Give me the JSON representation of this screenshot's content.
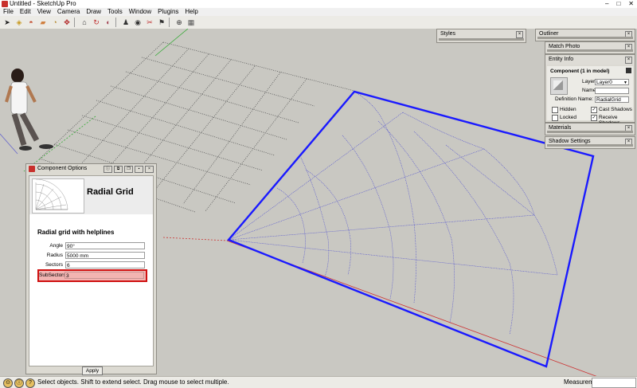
{
  "window": {
    "title": "Untitled - SketchUp Pro",
    "minimize": "–",
    "maximize": "□",
    "close": "✕"
  },
  "menu": [
    "File",
    "Edit",
    "View",
    "Camera",
    "Draw",
    "Tools",
    "Window",
    "Plugins",
    "Help"
  ],
  "toolbar": {
    "groups": [
      [
        "select-icon",
        "component-icon",
        "paint-bucket-icon",
        "eraser-icon",
        "tape-measure-icon",
        "move-icon"
      ],
      [
        "component-options-icon",
        "rotate-icon",
        "shape-icon",
        "walk-icon",
        "look-around-icon"
      ],
      [
        "section-icon",
        "position-camera-icon"
      ],
      [
        "add-location-icon",
        "toggle-terrain-icon"
      ]
    ]
  },
  "trays": {
    "styles": "Styles",
    "outliner": "Outliner",
    "match_photo": "Match Photo",
    "entity_info": {
      "title": "Entity Info",
      "heading": "Component (1 in model)",
      "layer_label": "Layer:",
      "layer_value": "Layer0",
      "name_label": "Name:",
      "name_value": "",
      "definition_label": "Definition Name:",
      "definition_value": "RadialGrid",
      "hidden": "Hidden",
      "locked": "Locked",
      "cast_shadows": "Cast Shadows",
      "receive_shadows": "Receive Shadows"
    },
    "materials": "Materials",
    "shadow_settings": "Shadow Settings"
  },
  "component_options": {
    "title": "Component Options",
    "name": "Radial Grid",
    "subtitle": "Radial grid with helplines",
    "fields": [
      {
        "label": "Angle",
        "value": "90°"
      },
      {
        "label": "Radius",
        "value": "5000 mm"
      },
      {
        "label": "Sectors",
        "value": "6"
      },
      {
        "label": "SubSectors",
        "value": "3"
      }
    ],
    "apply": "Apply"
  },
  "status": {
    "text": "Select objects. Shift to extend select. Drag mouse to select multiple.",
    "measurements_label": "Measurements",
    "measurements_value": ""
  },
  "colors": {
    "selection": "#1a1aff",
    "highlight": "#d01010",
    "background": "#c9c8c2"
  }
}
